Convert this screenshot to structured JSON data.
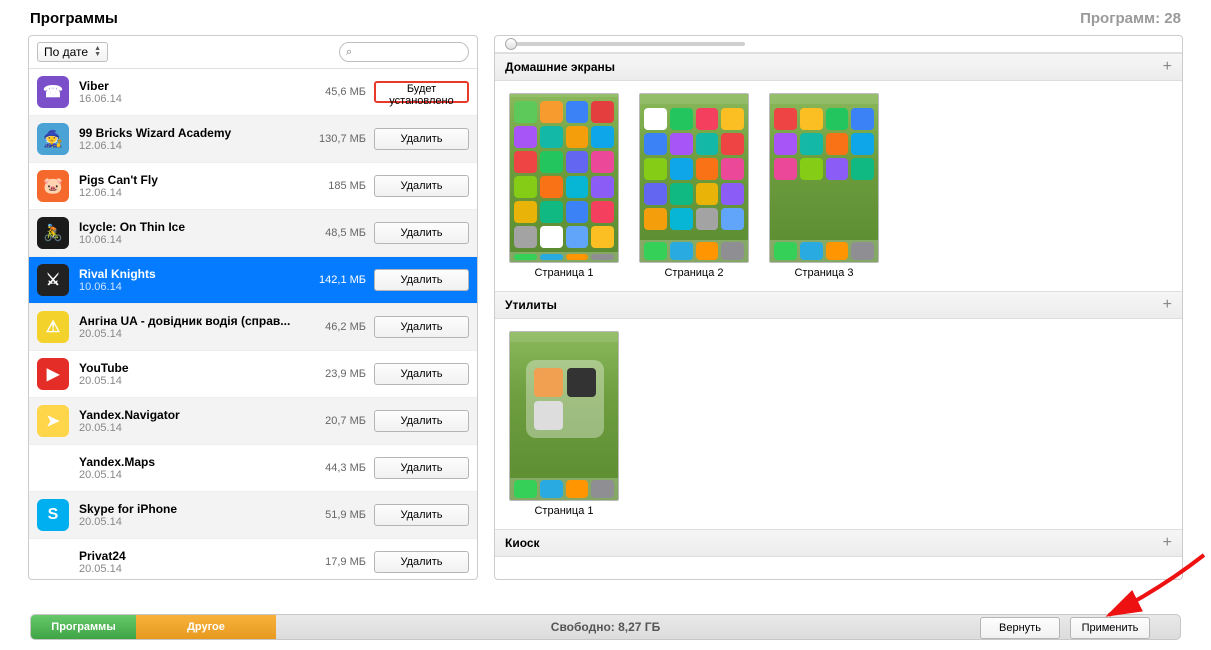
{
  "header": {
    "title": "Программы",
    "count_label": "Программ: 28"
  },
  "sort": {
    "label": "По дате"
  },
  "search": {
    "placeholder": ""
  },
  "apps": [
    {
      "name": "Viber",
      "date": "16.06.14",
      "size": "45,6 МБ",
      "action": "Будет установлено",
      "install": true,
      "color": "#7b4fc9",
      "glyph": "☎"
    },
    {
      "name": "99 Bricks Wizard Academy",
      "date": "12.06.14",
      "size": "130,7 МБ",
      "action": "Удалить",
      "color": "#4aa3d4",
      "glyph": "🧙"
    },
    {
      "name": "Pigs Can't Fly",
      "date": "12.06.14",
      "size": "185 МБ",
      "action": "Удалить",
      "color": "#f56a2c",
      "glyph": "🐷"
    },
    {
      "name": "Icycle: On Thin Ice",
      "date": "10.06.14",
      "size": "48,5 МБ",
      "action": "Удалить",
      "color": "#1a1a1a",
      "glyph": "🚴"
    },
    {
      "name": "Rival Knights",
      "date": "10.06.14",
      "size": "142,1 МБ",
      "action": "Удалить",
      "color": "#222",
      "glyph": "⚔",
      "selected": true
    },
    {
      "name": "Ангіна UA - довідник водія (справ...",
      "date": "20.05.14",
      "size": "46,2 МБ",
      "action": "Удалить",
      "color": "#f3d22b",
      "glyph": "⚠"
    },
    {
      "name": "YouTube",
      "date": "20.05.14",
      "size": "23,9 МБ",
      "action": "Удалить",
      "color": "#e52d27",
      "glyph": "▶"
    },
    {
      "name": "Yandex.Navigator",
      "date": "20.05.14",
      "size": "20,7 МБ",
      "action": "Удалить",
      "color": "#ffd54a",
      "glyph": "➤"
    },
    {
      "name": "Yandex.Maps",
      "date": "20.05.14",
      "size": "44,3 МБ",
      "action": "Удалить",
      "color": "#fff",
      "glyph": "🗺"
    },
    {
      "name": "Skype for iPhone",
      "date": "20.05.14",
      "size": "51,9 МБ",
      "action": "Удалить",
      "color": "#00aff0",
      "glyph": "S"
    },
    {
      "name": "Privat24",
      "date": "20.05.14",
      "size": "17,9 МБ",
      "action": "Удалить",
      "color": "#fff",
      "glyph": "24"
    }
  ],
  "sections": {
    "home": {
      "title": "Домашние экраны",
      "pages": [
        "Страница 1",
        "Страница 2",
        "Страница 3"
      ]
    },
    "util": {
      "title": "Утилиты",
      "pages": [
        "Страница 1"
      ]
    },
    "kiosk": {
      "title": "Киоск"
    }
  },
  "storage": {
    "apps": "Программы",
    "other": "Другое",
    "free": "Свободно: 8,27 ГБ"
  },
  "buttons": {
    "revert": "Вернуть",
    "apply": "Применить"
  },
  "page_colors": [
    [
      "#5cc95a",
      "#f79b2e",
      "#3b82f6",
      "#e53e3e",
      "#a855f7",
      "#14b8a6",
      "#f59e0b",
      "#0ea5e9",
      "#ef4444",
      "#22c55e",
      "#6366f1",
      "#ec4899",
      "#84cc16",
      "#f97316",
      "#06b6d4",
      "#8b5cf6",
      "#eab308",
      "#10b981",
      "#3b82f6",
      "#f43f5e",
      "#a3a3a3",
      "#fff",
      "#60a5fa",
      "#fbbf24"
    ],
    [
      "#fff",
      "#22c55e",
      "#f43f5e",
      "#fbbf24",
      "#3b82f6",
      "#a855f7",
      "#14b8a6",
      "#ef4444",
      "#84cc16",
      "#0ea5e9",
      "#f97316",
      "#ec4899",
      "#6366f1",
      "#10b981",
      "#eab308",
      "#8b5cf6",
      "#f59e0b",
      "#06b6d4",
      "#a3a3a3",
      "#60a5fa"
    ],
    [
      "#ef4444",
      "#fbbf24",
      "#22c55e",
      "#3b82f6",
      "#a855f7",
      "#14b8a6",
      "#f97316",
      "#0ea5e9",
      "#ec4899",
      "#84cc16",
      "#8b5cf6",
      "#10b981"
    ]
  ],
  "dock_colors": [
    "#34d058",
    "#29abe2",
    "#ff9500",
    "#8e8e93"
  ]
}
